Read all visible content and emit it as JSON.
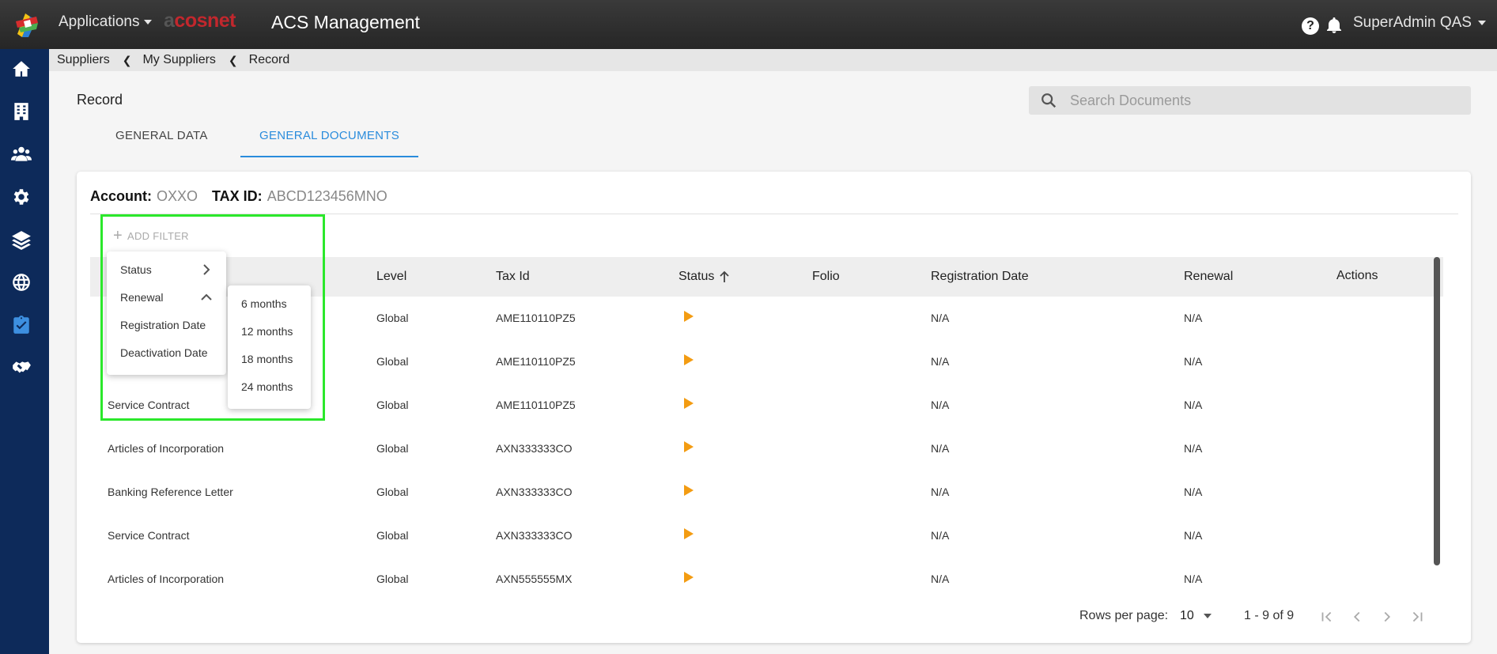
{
  "topbar": {
    "applications_label": "Applications",
    "brand_prefix": "a",
    "brand_mid": "c",
    "brand_rest": "osnet",
    "app_title": "ACS Management",
    "help_label": "?",
    "user_label": "SuperAdmin QAS"
  },
  "sidebar": {
    "items": [
      "home-icon",
      "building-icon",
      "users-icon",
      "gear-icon",
      "layers-icon",
      "globe-icon",
      "clipboard-check-icon",
      "handshake-icon"
    ],
    "active_item": "clipboard-check-icon",
    "active_color": "#3d8fe0",
    "background": "#0d2a5a"
  },
  "breadcrumb": {
    "items": [
      "Suppliers",
      "My Suppliers",
      "Record"
    ]
  },
  "page": {
    "title": "Record",
    "search_placeholder": "Search Documents"
  },
  "tabs": [
    {
      "label": "GENERAL DATA",
      "active": false
    },
    {
      "label": "GENERAL DOCUMENTS",
      "active": true
    }
  ],
  "account": {
    "account_label": "Account:",
    "account_value": "OXXO",
    "taxid_label": "TAX ID:",
    "taxid_value": "ABCD123456MNO"
  },
  "filter": {
    "add_label": "ADD FILTER",
    "menu": [
      "Status",
      "Renewal",
      "Registration Date",
      "Deactivation Date"
    ],
    "renewal_options": [
      "6 months",
      "12 months",
      "18 months",
      "24 months"
    ]
  },
  "table": {
    "columns": [
      "Level",
      "Tax Id",
      "Status",
      "Folio",
      "Registration Date",
      "Renewal",
      "Actions"
    ],
    "rows": [
      {
        "name": "",
        "level": "Global",
        "tax_id": "AME110110PZ5",
        "folio": "",
        "registration_date": "N/A",
        "renewal": "N/A"
      },
      {
        "name": "",
        "level": "Global",
        "tax_id": "AME110110PZ5",
        "folio": "",
        "registration_date": "N/A",
        "renewal": "N/A"
      },
      {
        "name": "Service Contract",
        "level": "Global",
        "tax_id": "AME110110PZ5",
        "folio": "",
        "registration_date": "N/A",
        "renewal": "N/A"
      },
      {
        "name": "Articles of Incorporation",
        "level": "Global",
        "tax_id": "AXN333333CO",
        "folio": "",
        "registration_date": "N/A",
        "renewal": "N/A"
      },
      {
        "name": "Banking Reference Letter",
        "level": "Global",
        "tax_id": "AXN333333CO",
        "folio": "",
        "registration_date": "N/A",
        "renewal": "N/A"
      },
      {
        "name": "Service Contract",
        "level": "Global",
        "tax_id": "AXN333333CO",
        "folio": "",
        "registration_date": "N/A",
        "renewal": "N/A"
      },
      {
        "name": "Articles of Incorporation",
        "level": "Global",
        "tax_id": "AXN555555MX",
        "folio": "",
        "registration_date": "N/A",
        "renewal": "N/A"
      }
    ],
    "status_color": "#f39c12"
  },
  "pagination": {
    "rows_per_page_label": "Rows per page:",
    "rows_per_page_value": "10",
    "range_label": "1 - 9 of 9"
  }
}
